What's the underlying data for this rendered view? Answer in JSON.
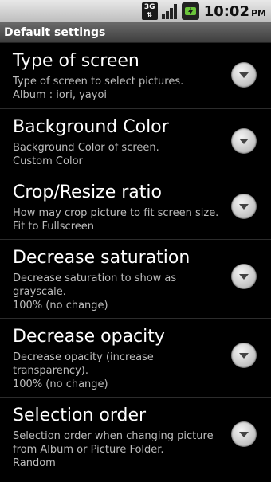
{
  "status": {
    "network": "3G",
    "time": "10:02",
    "ampm": "PM"
  },
  "title": "Default settings",
  "prefs": [
    {
      "title": "Type of screen",
      "summary": "Type of screen to select pictures.",
      "value": "Album : iori, yayoi"
    },
    {
      "title": "Background Color",
      "summary": "Background Color of screen.",
      "value": "Custom Color"
    },
    {
      "title": "Crop/Resize ratio",
      "summary": "How may crop picture to fit screen size.",
      "value": "Fit to Fullscreen"
    },
    {
      "title": "Decrease saturation",
      "summary": "Decrease saturation to show as grayscale.",
      "value": "100% (no change)"
    },
    {
      "title": "Decrease opacity",
      "summary": "Decrease opacity (increase transparency).",
      "value": "100% (no change)"
    },
    {
      "title": "Selection order",
      "summary": "Selection order when changing picture from Album or Picture Folder.",
      "value": "Random"
    }
  ],
  "icons": {
    "dropdown": "chevron-down-icon"
  }
}
